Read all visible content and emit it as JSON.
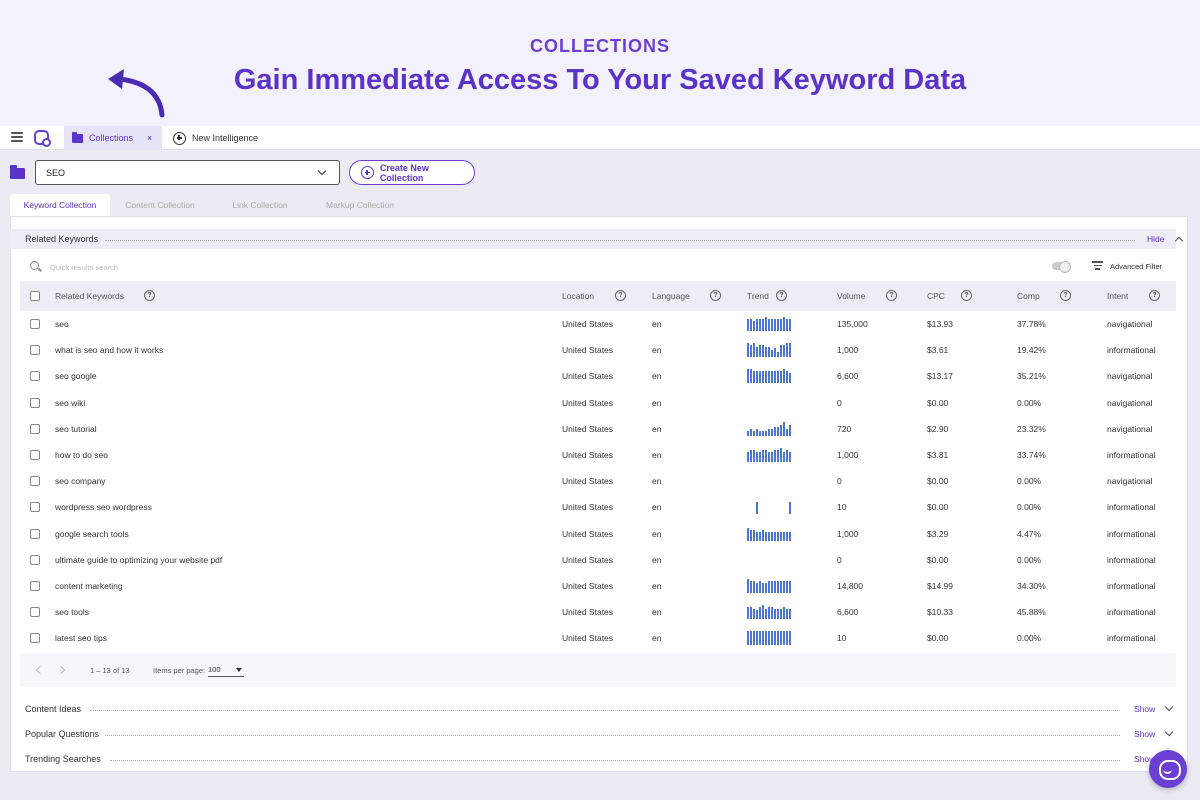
{
  "hero": {
    "eyebrow": "COLLECTIONS",
    "title": "Gain Immediate Access To Your Saved Keyword Data"
  },
  "topbar": {
    "tabs": [
      {
        "label": "Collections",
        "icon": "folder-icon",
        "active": true
      },
      {
        "label": "New Intelligence",
        "icon": "plus-circle-icon",
        "active": false
      }
    ],
    "close_label": "×"
  },
  "toolbar": {
    "collection_value": "SEO",
    "create_label": "Create New Collection"
  },
  "subtabs": [
    {
      "label": "Keyword Collection"
    },
    {
      "label": "Content Collection"
    },
    {
      "label": "Link Collection"
    },
    {
      "label": "Markup Collection"
    }
  ],
  "related": {
    "title": "Related Keywords",
    "hide_label": "Hide",
    "search_placeholder": "Quick results search",
    "advanced_filter": "Advanced Filter",
    "columns": [
      "Related Keywords",
      "Location",
      "Language",
      "Trend",
      "Volume",
      "CPC",
      "Comp",
      "Intent"
    ],
    "rows": [
      {
        "keyword": "seo",
        "location": "United States",
        "language": "en",
        "volume": "135,000",
        "cpc": "$13.93",
        "comp": "37.78%",
        "intent": "navigational",
        "trend": [
          7,
          7,
          6,
          7,
          7,
          7,
          8,
          7,
          7,
          7,
          7,
          7,
          8,
          7,
          7
        ]
      },
      {
        "keyword": "what is seo and how it works",
        "location": "United States",
        "language": "en",
        "volume": "1,000",
        "cpc": "$3.61",
        "comp": "19.42%",
        "intent": "informational",
        "trend": [
          8,
          7,
          8,
          6,
          7,
          7,
          6,
          6,
          4,
          5,
          3,
          7,
          7,
          8,
          8
        ]
      },
      {
        "keyword": "seo google",
        "location": "United States",
        "language": "en",
        "volume": "6,600",
        "cpc": "$13.17",
        "comp": "35.21%",
        "intent": "navigational",
        "trend": [
          8,
          8,
          7,
          7,
          7,
          7,
          7,
          7,
          7,
          7,
          7,
          7,
          8,
          7,
          6
        ]
      },
      {
        "keyword": "seo wiki",
        "location": "United States",
        "language": "en",
        "volume": "0",
        "cpc": "$0.00",
        "comp": "0.00%",
        "intent": "navigational",
        "trend": []
      },
      {
        "keyword": "seo tutorial",
        "location": "United States",
        "language": "en",
        "volume": "720",
        "cpc": "$2.90",
        "comp": "23.32%",
        "intent": "navigational",
        "trend": [
          3,
          4,
          3,
          4,
          3,
          3,
          3,
          4,
          4,
          5,
          5,
          6,
          8,
          4,
          6
        ]
      },
      {
        "keyword": "how to do seo",
        "location": "United States",
        "language": "en",
        "volume": "1,000",
        "cpc": "$3.81",
        "comp": "33.74%",
        "intent": "informational",
        "trend": [
          6,
          7,
          7,
          6,
          6,
          7,
          7,
          6,
          6,
          7,
          7,
          8,
          6,
          7,
          6
        ]
      },
      {
        "keyword": "seo company",
        "location": "United States",
        "language": "en",
        "volume": "0",
        "cpc": "$0.00",
        "comp": "0.00%",
        "intent": "navigational",
        "trend": []
      },
      {
        "keyword": "wordpress seo wordpress",
        "location": "United States",
        "language": "en",
        "volume": "10",
        "cpc": "$0.00",
        "comp": "0.00%",
        "intent": "informational",
        "trend": [
          0,
          0,
          0,
          7,
          0,
          0,
          0,
          0,
          0,
          0,
          0,
          0,
          0,
          0,
          7
        ]
      },
      {
        "keyword": "google search tools",
        "location": "United States",
        "language": "en",
        "volume": "1,000",
        "cpc": "$3.29",
        "comp": "4.47%",
        "intent": "informational",
        "trend": [
          7,
          6,
          6,
          5,
          5,
          6,
          5,
          5,
          5,
          5,
          5,
          5,
          5,
          5,
          5
        ]
      },
      {
        "keyword": "ultimate guide to optimizing your website pdf",
        "location": "United States",
        "language": "en",
        "volume": "0",
        "cpc": "$0.00",
        "comp": "0.00%",
        "intent": "informational",
        "trend": []
      },
      {
        "keyword": "content marketing",
        "location": "United States",
        "language": "en",
        "volume": "14,800",
        "cpc": "$14.99",
        "comp": "34.30%",
        "intent": "informational",
        "trend": [
          8,
          7,
          7,
          6,
          7,
          6,
          6,
          7,
          7,
          7,
          7,
          7,
          7,
          7,
          7
        ]
      },
      {
        "keyword": "seo tools",
        "location": "United States",
        "language": "en",
        "volume": "6,600",
        "cpc": "$10.33",
        "comp": "45.88%",
        "intent": "informational",
        "trend": [
          7,
          7,
          6,
          5,
          7,
          8,
          6,
          7,
          7,
          6,
          6,
          6,
          7,
          6,
          6
        ]
      },
      {
        "keyword": "latest seo tips",
        "location": "United States",
        "language": "en",
        "volume": "10",
        "cpc": "$0.00",
        "comp": "0.00%",
        "intent": "informational",
        "trend": [
          8,
          8,
          8,
          8,
          8,
          8,
          8,
          8,
          8,
          8,
          8,
          8,
          8,
          8,
          8
        ]
      }
    ],
    "pagination": {
      "range": "1 – 13 of 13",
      "per_page_label": "Items per page:",
      "per_page_value": "100"
    }
  },
  "sections": [
    {
      "title": "Content Ideas",
      "action": "Show"
    },
    {
      "title": "Popular Questions",
      "action": "Show"
    },
    {
      "title": "Trending Searches",
      "action": "Show"
    }
  ],
  "colors": {
    "accent": "#5b33c9",
    "trend": "#4b77d1"
  }
}
